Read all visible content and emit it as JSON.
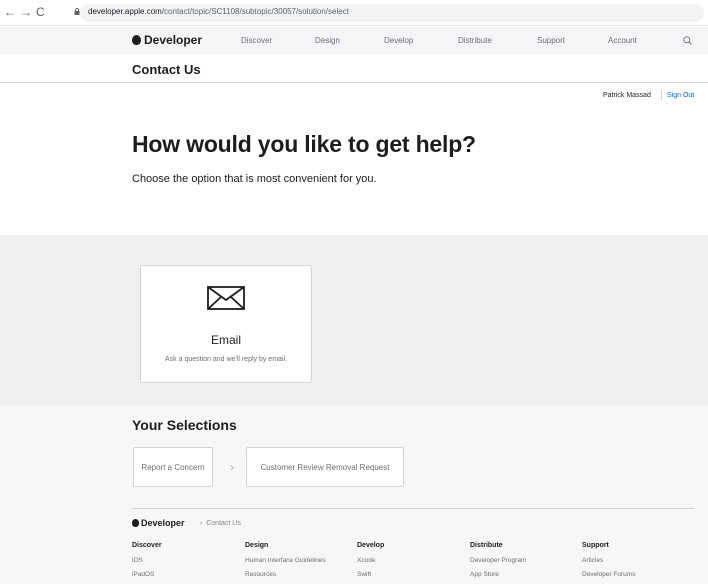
{
  "browser": {
    "url_host": "developer.apple.com",
    "url_path": "/contact/topic/SC1108/subtopic/30057/solution/select"
  },
  "globalnav": {
    "brand": "Developer",
    "items": [
      "Discover",
      "Design",
      "Develop",
      "Distribute",
      "Support",
      "Account"
    ]
  },
  "localnav": {
    "title": "Contact Us"
  },
  "user": {
    "name": "Patrick Massad",
    "signout": "Sign Out"
  },
  "hero": {
    "title": "How would you like to get help?",
    "subtitle": "Choose the option that is most convenient for you."
  },
  "option": {
    "title": "Email",
    "description": "Ask a question and we'll reply by email.",
    "icon": "envelope-icon"
  },
  "selections": {
    "title": "Your Selections",
    "items": [
      "Report a Concern",
      "Customer Review Removal Request"
    ]
  },
  "footer": {
    "brand": "Developer",
    "crumb": "Contact Us",
    "columns": [
      {
        "heading": "Discover",
        "links": [
          "iOS",
          "iPadOS"
        ]
      },
      {
        "heading": "Design",
        "links": [
          "Human Interface Guidelines",
          "Resources"
        ]
      },
      {
        "heading": "Develop",
        "links": [
          "Xcode",
          "Swift"
        ]
      },
      {
        "heading": "Distribute",
        "links": [
          "Developer Program",
          "App Store"
        ]
      },
      {
        "heading": "Support",
        "links": [
          "Articles",
          "Developer Forums"
        ]
      }
    ]
  },
  "colors": {
    "link": "#0066cc",
    "band": "#f0f0f0",
    "text": "#1d1d1f"
  }
}
